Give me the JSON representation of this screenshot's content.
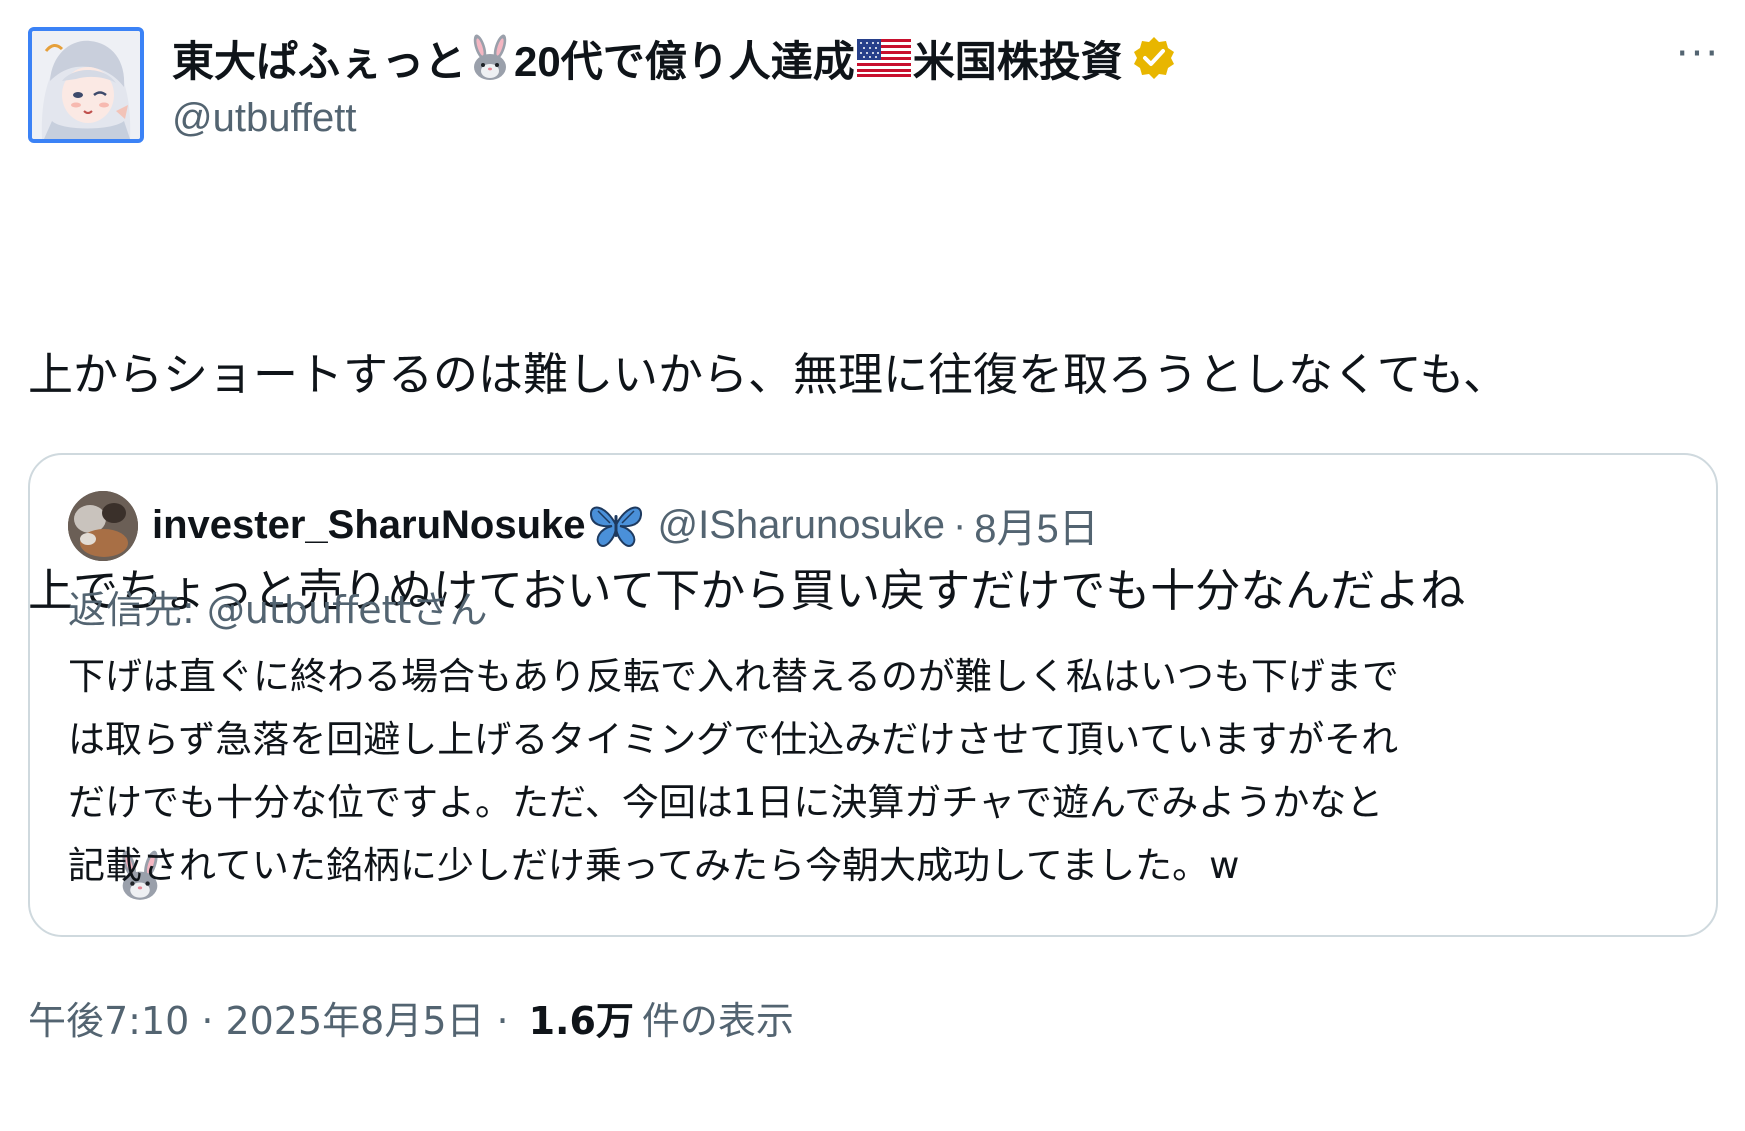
{
  "author": {
    "name_part1": "東大ぱふぇっと",
    "name_part2": "20代で億り人達成",
    "name_part3": "米国株投資",
    "handle": "@utbuffett",
    "verified": true,
    "badge_color": "#e8b600"
  },
  "more_label": "···",
  "body": {
    "line1": "上からショートするのは難しいから、無理に往復を取ろうとしなくても、",
    "line2": "上でちょっと売りぬけておいて下から買い戻すだけでも十分なんだよね"
  },
  "quote": {
    "name": "invester_SharuNosuke",
    "handle": "@ISharunosuke",
    "dot": "·",
    "date": "8月5日",
    "reply_prefix": "返信先: ",
    "reply_target": "@utbuffettさん",
    "lines": [
      "下げは直ぐに終わる場合もあり反転で入れ替えるのが難しく私はいつも下げまで",
      "は取らず急落を回避し上げるタイミングで仕込みだけさせて頂いていますがそれ",
      "だけでも十分な位ですよ。ただ、今回は1日に決算ガチャで遊んでみようかなと",
      "記載されていた銘柄に少しだけ乗ってみたら今朝大成功してました。w"
    ]
  },
  "footer": {
    "time": "午後7:10",
    "sep1": "·",
    "date": "2025年8月5日",
    "sep2": "·",
    "views_count": "1.6万",
    "views_label": "件の表示"
  },
  "colors": {
    "text": "#0f1419",
    "secondary": "#536471",
    "border": "#cfd9de",
    "avatar_border": "#3b82f6"
  },
  "icons": {
    "rabbit": "rabbit-face-emoji",
    "flag": "us-flag-emoji",
    "butterfly": "butterfly-emoji",
    "verified": "verified-badge-icon",
    "more": "more-options-icon"
  }
}
